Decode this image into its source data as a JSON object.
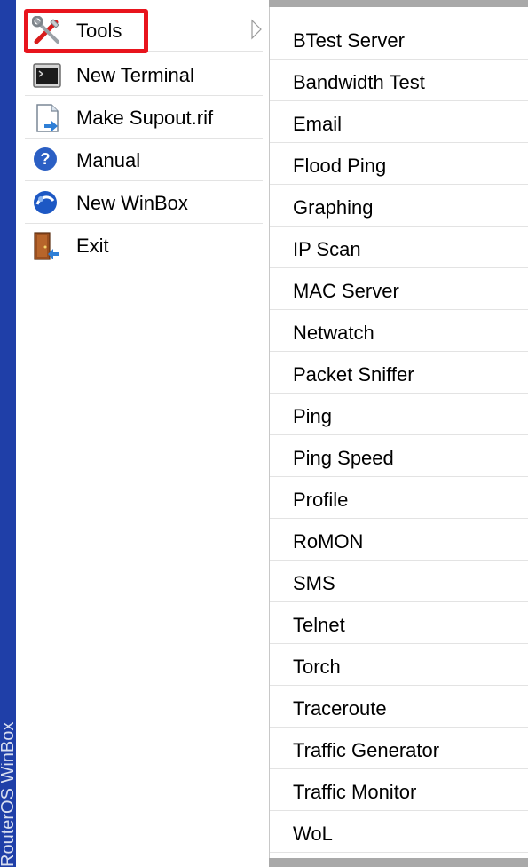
{
  "sidebar": {
    "vertical_label": "RouterOS WinBox",
    "color": "#1f3fa8"
  },
  "main_menu": {
    "items": [
      {
        "label": "Tools",
        "icon": "tools-icon",
        "has_submenu": true,
        "highlighted": true
      },
      {
        "label": "New Terminal",
        "icon": "terminal-icon"
      },
      {
        "label": "Make Supout.rif",
        "icon": "file-export-icon"
      },
      {
        "label": "Manual",
        "icon": "help-icon"
      },
      {
        "label": "New WinBox",
        "icon": "winbox-icon"
      },
      {
        "label": "Exit",
        "icon": "exit-door-icon"
      }
    ]
  },
  "submenu": {
    "items": [
      "BTest Server",
      "Bandwidth Test",
      "Email",
      "Flood Ping",
      "Graphing",
      "IP Scan",
      "MAC Server",
      "Netwatch",
      "Packet Sniffer",
      "Ping",
      "Ping Speed",
      "Profile",
      "RoMON",
      "SMS",
      "Telnet",
      "Torch",
      "Traceroute",
      "Traffic Generator",
      "Traffic Monitor",
      "WoL"
    ]
  },
  "colors": {
    "highlight_border": "#e8141d",
    "separator": "#e3e3e3",
    "scroll_bar": "#a9a9a9"
  }
}
